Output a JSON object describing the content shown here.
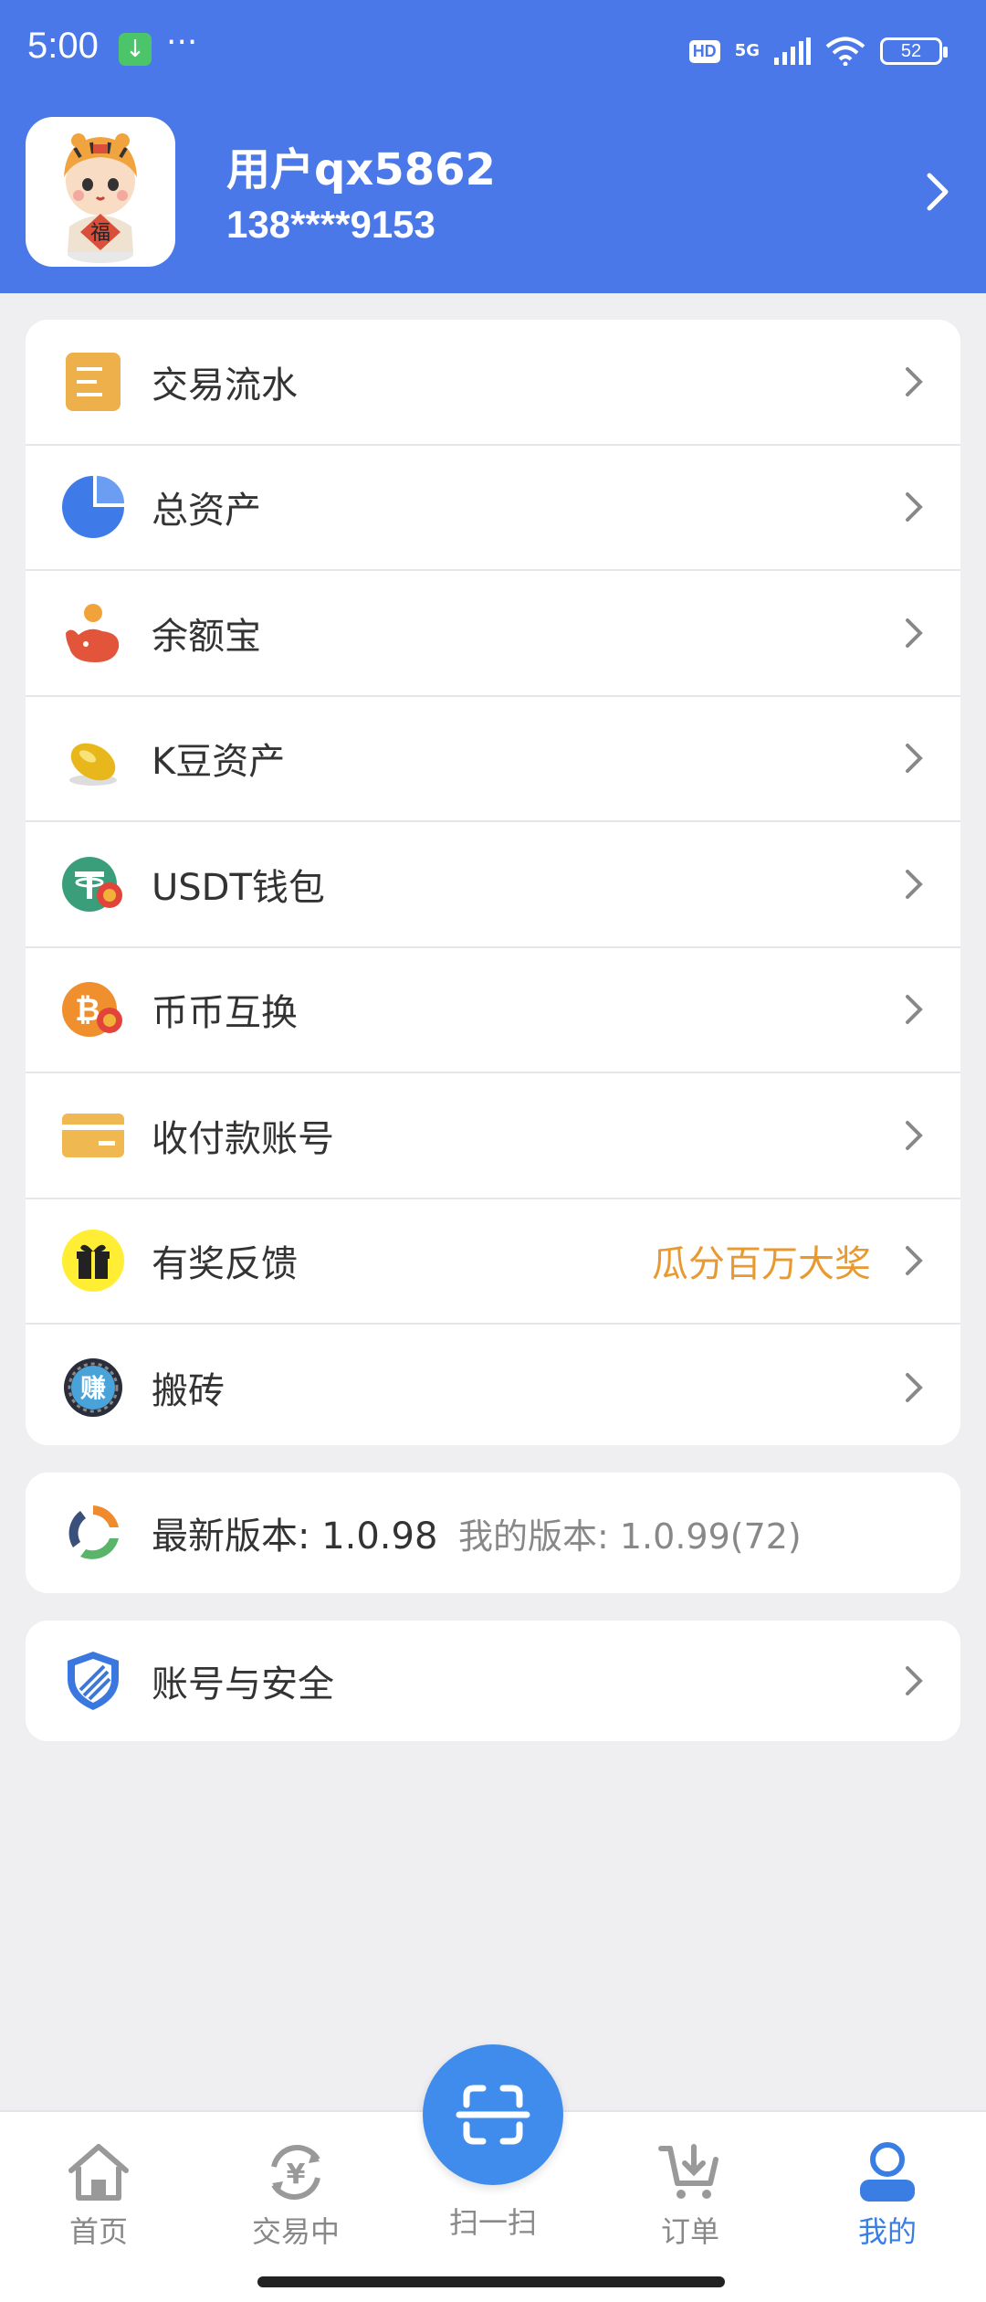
{
  "status_bar": {
    "time": "5:00",
    "network": "5G",
    "hd": "HD",
    "battery": "52"
  },
  "profile": {
    "username": "用户qx5862",
    "phone": "138****9153"
  },
  "menu": [
    {
      "label": "交易流水",
      "icon": "list-icon",
      "extra": ""
    },
    {
      "label": "总资产",
      "icon": "pie-chart-icon",
      "extra": ""
    },
    {
      "label": "余额宝",
      "icon": "whale-icon",
      "extra": ""
    },
    {
      "label": "K豆资产",
      "icon": "gold-bean-icon",
      "extra": ""
    },
    {
      "label": "USDT钱包",
      "icon": "usdt-icon",
      "extra": ""
    },
    {
      "label": "币币互换",
      "icon": "bitcoin-swap-icon",
      "extra": ""
    },
    {
      "label": "收付款账号",
      "icon": "card-icon",
      "extra": ""
    },
    {
      "label": "有奖反馈",
      "icon": "gift-icon",
      "extra": "瓜分百万大奖"
    },
    {
      "label": "搬砖",
      "icon": "earn-coin-icon",
      "extra": ""
    }
  ],
  "version": {
    "latest": "最新版本: 1.0.98",
    "mine": "我的版本: 1.0.99(72)"
  },
  "security": {
    "label": "账号与安全"
  },
  "bottom_nav": {
    "home": "首页",
    "trading": "交易中",
    "scan": "扫一扫",
    "orders": "订单",
    "mine": "我的"
  },
  "colors": {
    "primary": "#4a78e8",
    "accent": "#e89a30",
    "active_tab": "#3a7ee4"
  }
}
